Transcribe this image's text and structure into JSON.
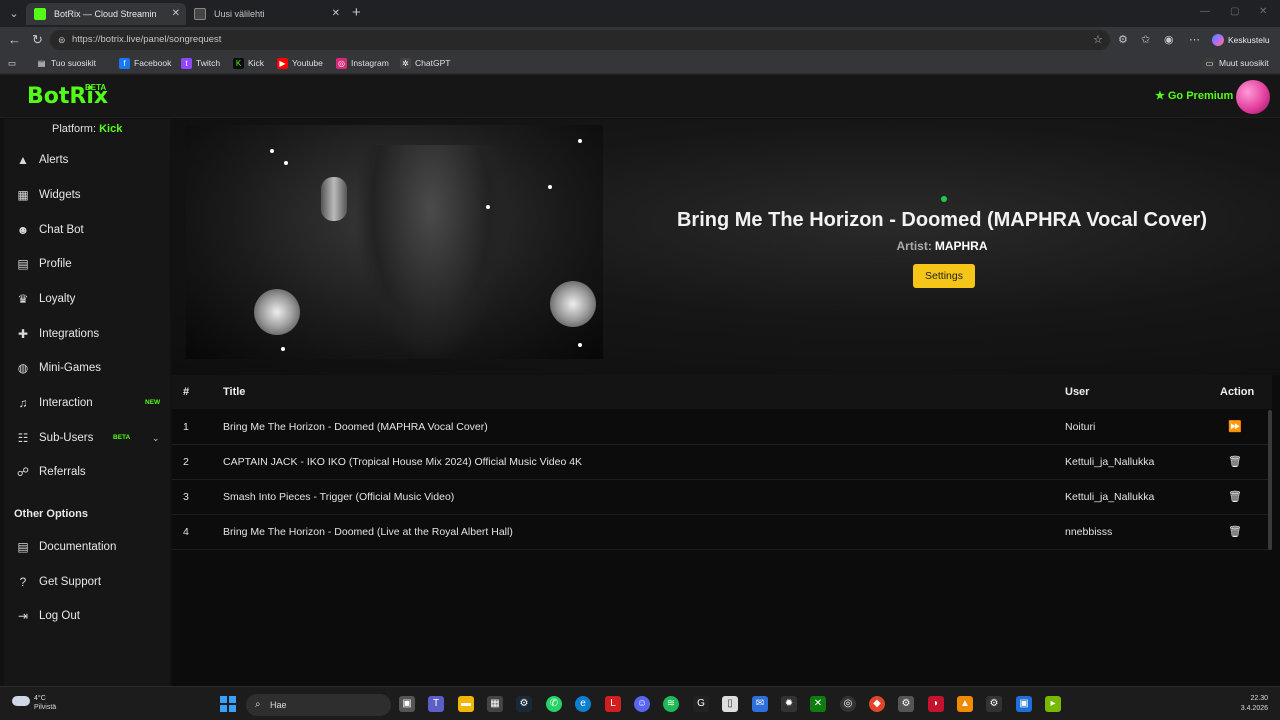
{
  "browser": {
    "tabs": [
      {
        "label": "BotRix — Cloud Streaming Bot",
        "active": true
      },
      {
        "label": "Uusi välilehti",
        "active": false
      }
    ],
    "url": "https://botrix.live/panel/songrequest",
    "chat_label": "Keskustelu",
    "bookmarks": [
      {
        "label": "Tuo suosikit",
        "icon": "import-icon",
        "color": "#3a3a3a"
      },
      {
        "label": "Facebook",
        "icon": "facebook-icon",
        "color": "#1877f2"
      },
      {
        "label": "Twitch",
        "icon": "twitch-icon",
        "color": "#9146ff"
      },
      {
        "label": "Kick",
        "icon": "kick-icon",
        "color": "#0b0b0b"
      },
      {
        "label": "Youtube",
        "icon": "youtube-icon",
        "color": "#ff0000"
      },
      {
        "label": "Instagram",
        "icon": "instagram-icon",
        "color": "#d62976"
      },
      {
        "label": "ChatGPT",
        "icon": "chatgpt-icon",
        "color": "#444"
      }
    ],
    "other_bookmarks": "Muut suosikit"
  },
  "app": {
    "logo": "BotRix",
    "logo_badge": "BETA",
    "premium_label": "Go Premium",
    "accent": "#53fc18",
    "platform_label": "Platform:",
    "platform_value": "Kick"
  },
  "sidebar": {
    "items": [
      {
        "label": "Alerts",
        "icon": "warning-icon"
      },
      {
        "label": "Widgets",
        "icon": "grid-icon"
      },
      {
        "label": "Chat Bot",
        "icon": "robot-icon"
      },
      {
        "label": "Profile",
        "icon": "profile-card-icon"
      },
      {
        "label": "Loyalty",
        "icon": "trophy-icon"
      },
      {
        "label": "Integrations",
        "icon": "puzzle-icon"
      },
      {
        "label": "Mini-Games",
        "icon": "gamepad-icon"
      },
      {
        "label": "Interaction",
        "icon": "music-note-icon",
        "badge": "NEW"
      },
      {
        "label": "Sub-Users",
        "icon": "users-icon",
        "badge": "BETA"
      },
      {
        "label": "Referrals",
        "icon": "referral-icon"
      }
    ],
    "other_options_heading": "Other Options",
    "other_items": [
      {
        "label": "Documentation",
        "icon": "document-icon"
      },
      {
        "label": "Get Support",
        "icon": "question-icon"
      },
      {
        "label": "Log Out",
        "icon": "logout-icon"
      }
    ]
  },
  "now_playing": {
    "title": "Bring Me The Horizon - Doomed (MAPHRA Vocal Cover)",
    "artist_label": "Artist:",
    "artist": "MAPHRA",
    "settings_label": "Settings"
  },
  "queue": {
    "headers": {
      "num": "#",
      "title": "Title",
      "user": "User",
      "action": "Action"
    },
    "rows": [
      {
        "num": "1",
        "title": "Bring Me The Horizon - Doomed (MAPHRA Vocal Cover)",
        "user": "Noituri",
        "action_icon": "skip-forward-icon"
      },
      {
        "num": "2",
        "title": "CAPTAIN JACK - IKO IKO (Tropical House Mix 2024) Official Music Video 4K",
        "user": "Kettuli_ja_Nallukka",
        "action_icon": "trash-icon"
      },
      {
        "num": "3",
        "title": "Smash Into Pieces - Trigger (Official Music Video)",
        "user": "Kettuli_ja_Nallukka",
        "action_icon": "trash-icon"
      },
      {
        "num": "4",
        "title": "Bring Me The Horizon - Doomed (Live at the Royal Albert Hall)",
        "user": "nnebbisss",
        "action_icon": "trash-icon"
      }
    ]
  },
  "taskbar": {
    "weather_temp": "4°C",
    "weather_desc": "Pilvistä",
    "search_placeholder": "Hae",
    "time": "22.30",
    "date": "3.4.2026"
  }
}
